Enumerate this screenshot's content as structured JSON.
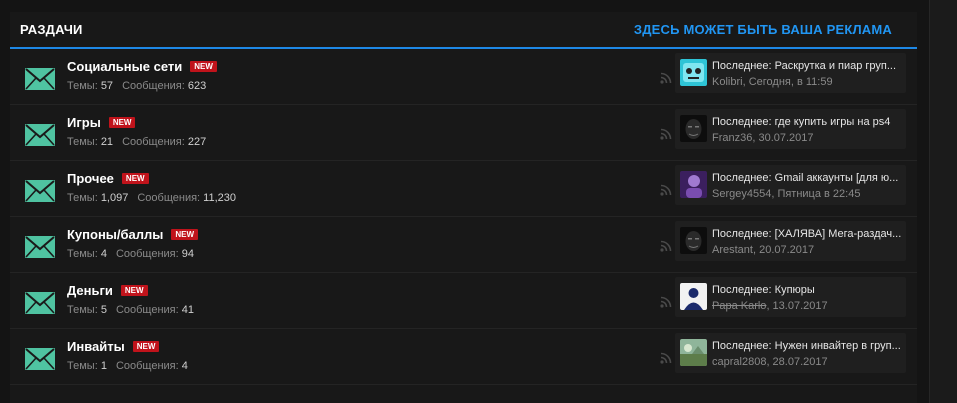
{
  "header": {
    "title": "РАЗДАЧИ",
    "ad": "ЗДЕСЬ МОЖЕТ БЫТЬ ВАША РЕКЛАМА"
  },
  "labels": {
    "topics": "Темы:",
    "messages": "Сообщения:",
    "badge": "NEW"
  },
  "colors": {
    "accent": "#1e88e5",
    "ad": "#2196f3",
    "badge": "#c0131b",
    "envelope": "#4fc3a1"
  },
  "forums": [
    {
      "name": "Социальные сети",
      "topics": "57",
      "messages": "623",
      "last_title": "Последнее: Раскрутка и пиар груп...",
      "last_user": "Kolibri",
      "last_date": ", Сегодня, в 11:59",
      "avatar_icon": "cyan-face-avatar"
    },
    {
      "name": "Игры",
      "topics": "21",
      "messages": "227",
      "last_title": "Последнее: где купить игры на ps4",
      "last_user": "Franz36",
      "last_date": ", 30.07.2017",
      "avatar_icon": "mask-avatar"
    },
    {
      "name": "Прочее",
      "topics": "1,097",
      "messages": "11,230",
      "last_title": "Последнее: Gmail аккаунты [для ю...",
      "last_user": "Sergey4554",
      "last_date": ", Пятница в 22:45",
      "avatar_icon": "purple-avatar"
    },
    {
      "name": "Купоны/баллы",
      "topics": "4",
      "messages": "94",
      "last_title": "Последнее: [ХАЛЯВА] Мега-раздач...",
      "last_user": "Arestant",
      "last_date": ", 20.07.2017",
      "avatar_icon": "mask-avatar"
    },
    {
      "name": "Деньги",
      "topics": "5",
      "messages": "41",
      "last_title": "Последнее: Купюры",
      "last_user": "Papa Karlo",
      "last_date": ", 13.07.2017",
      "avatar_icon": "man-avatar"
    },
    {
      "name": "Инвайты",
      "topics": "1",
      "messages": "4",
      "last_title": "Последнее: Нужен инвайтер в груп...",
      "last_user": "capral2808",
      "last_date": ", 28.07.2017",
      "avatar_icon": "landscape-avatar"
    }
  ]
}
